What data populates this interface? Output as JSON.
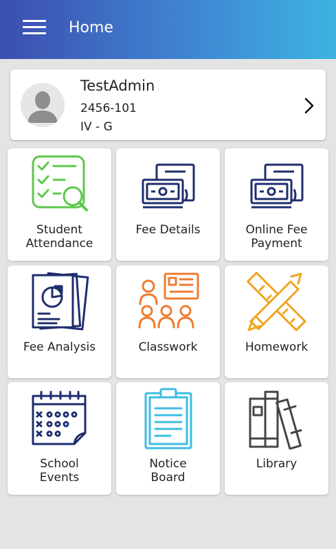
{
  "header": {
    "title": "Home",
    "menu_icon": "hamburger-menu-icon"
  },
  "profile": {
    "name": "TestAdmin",
    "id": "2456-101",
    "class": "IV - G",
    "avatar_icon": "user-avatar-icon",
    "chevron_icon": "chevron-right-icon"
  },
  "tiles": [
    {
      "label_line1": "Student",
      "label_line2": "Attendance",
      "icon": "attendance-checklist-icon",
      "color": "#5cc74a"
    },
    {
      "label_line1": "Fee Details",
      "label_line2": "",
      "icon": "money-bills-icon",
      "color": "#1f2d6e"
    },
    {
      "label_line1": "Online Fee",
      "label_line2": "Payment",
      "icon": "money-bills-icon",
      "color": "#1f2d6e"
    },
    {
      "label_line1": "Fee Analysis",
      "label_line2": "",
      "icon": "report-chart-icon",
      "color": "#1f2d6e"
    },
    {
      "label_line1": "Classwork",
      "label_line2": "",
      "icon": "classroom-icon",
      "color": "#f07b2f"
    },
    {
      "label_line1": "Homework",
      "label_line2": "",
      "icon": "pencil-ruler-icon",
      "color": "#f0a51f"
    },
    {
      "label_line1": "School",
      "label_line2": "Events",
      "icon": "calendar-icon",
      "color": "#1f2d6e"
    },
    {
      "label_line1": "Notice",
      "label_line2": "Board",
      "icon": "clipboard-icon",
      "color": "#3cbde0"
    },
    {
      "label_line1": "Library",
      "label_line2": "",
      "icon": "books-icon",
      "color": "#444444"
    }
  ]
}
